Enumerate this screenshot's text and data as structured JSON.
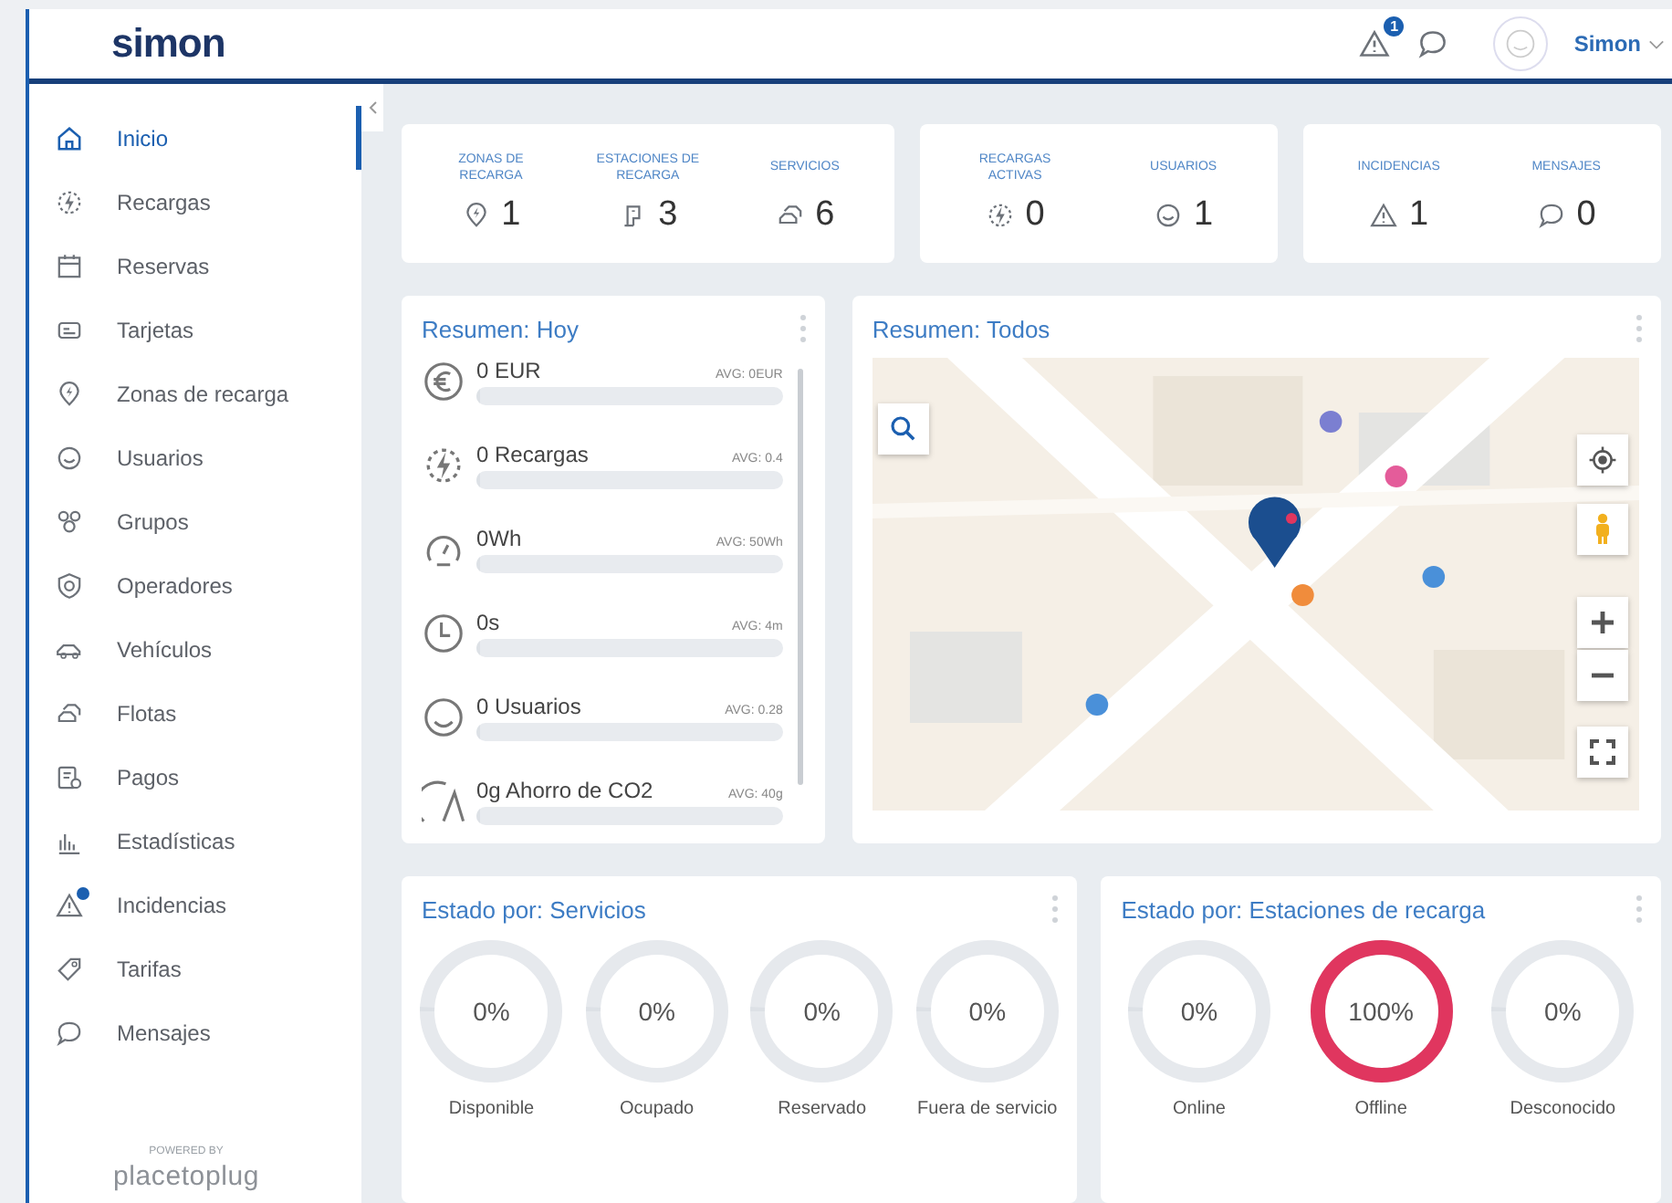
{
  "header": {
    "logo": "simon",
    "alerts_badge": "1",
    "user": "Simon"
  },
  "sidebar": {
    "items": [
      {
        "label": "Inicio",
        "selected": true,
        "badge": false
      },
      {
        "label": "Recargas",
        "selected": false,
        "badge": false
      },
      {
        "label": "Reservas",
        "selected": false,
        "badge": false
      },
      {
        "label": "Tarjetas",
        "selected": false,
        "badge": false
      },
      {
        "label": "Zonas de recarga",
        "selected": false,
        "badge": false
      },
      {
        "label": "Usuarios",
        "selected": false,
        "badge": false
      },
      {
        "label": "Grupos",
        "selected": false,
        "badge": false
      },
      {
        "label": "Operadores",
        "selected": false,
        "badge": false
      },
      {
        "label": "Vehículos",
        "selected": false,
        "badge": false
      },
      {
        "label": "Flotas",
        "selected": false,
        "badge": false
      },
      {
        "label": "Pagos",
        "selected": false,
        "badge": false
      },
      {
        "label": "Estadísticas",
        "selected": false,
        "badge": false
      },
      {
        "label": "Incidencias",
        "selected": false,
        "badge": true
      },
      {
        "label": "Tarifas",
        "selected": false,
        "badge": false
      },
      {
        "label": "Mensajes",
        "selected": false,
        "badge": false
      }
    ],
    "powered_by": "POWERED BY",
    "brand": "placetoplug"
  },
  "stat_groups": [
    [
      {
        "label": "ZONAS DE RECARGA",
        "value": "1"
      },
      {
        "label": "ESTACIONES DE RECARGA",
        "value": "3"
      },
      {
        "label": "SERVICIOS",
        "value": "6"
      }
    ],
    [
      {
        "label": "RECARGAS ACTIVAS",
        "value": "0"
      },
      {
        "label": "USUARIOS",
        "value": "1"
      }
    ],
    [
      {
        "label": "INCIDENCIAS",
        "value": "1"
      },
      {
        "label": "MENSAJES",
        "value": "0"
      }
    ]
  ],
  "summary_today": {
    "title": "Resumen: Hoy",
    "rows": [
      {
        "value": "0 EUR",
        "avg": "AVG: 0EUR",
        "level": 0
      },
      {
        "value": "0 Recargas",
        "avg": "AVG: 0.4",
        "level": 0
      },
      {
        "value": "0Wh",
        "avg": "AVG: 50Wh",
        "level": 0
      },
      {
        "value": "0s",
        "avg": "AVG: 4m",
        "level": 0
      },
      {
        "value": "0 Usuarios",
        "avg": "AVG: 0.28",
        "level": 0
      },
      {
        "value": "0g Ahorro de CO2",
        "avg": "AVG: 40g",
        "level": 0
      }
    ]
  },
  "summary_all": {
    "title": "Resumen: Todos"
  },
  "status_services": {
    "title": "Estado por: Servicios",
    "rings": [
      {
        "value": "0%",
        "label": "Disponible",
        "level": 0
      },
      {
        "value": "0%",
        "label": "Ocupado",
        "level": 0
      },
      {
        "value": "0%",
        "label": "Reservado",
        "level": 0
      },
      {
        "value": "0%",
        "label": "Fuera de servicio",
        "level": 0
      }
    ]
  },
  "status_stations": {
    "title": "Estado por: Estaciones de recarga",
    "rings": [
      {
        "value": "0%",
        "label": "Online",
        "level": 0
      },
      {
        "value": "100%",
        "label": "Offline",
        "level": 1
      },
      {
        "value": "0%",
        "label": "Desconocido",
        "level": 0
      }
    ]
  }
}
